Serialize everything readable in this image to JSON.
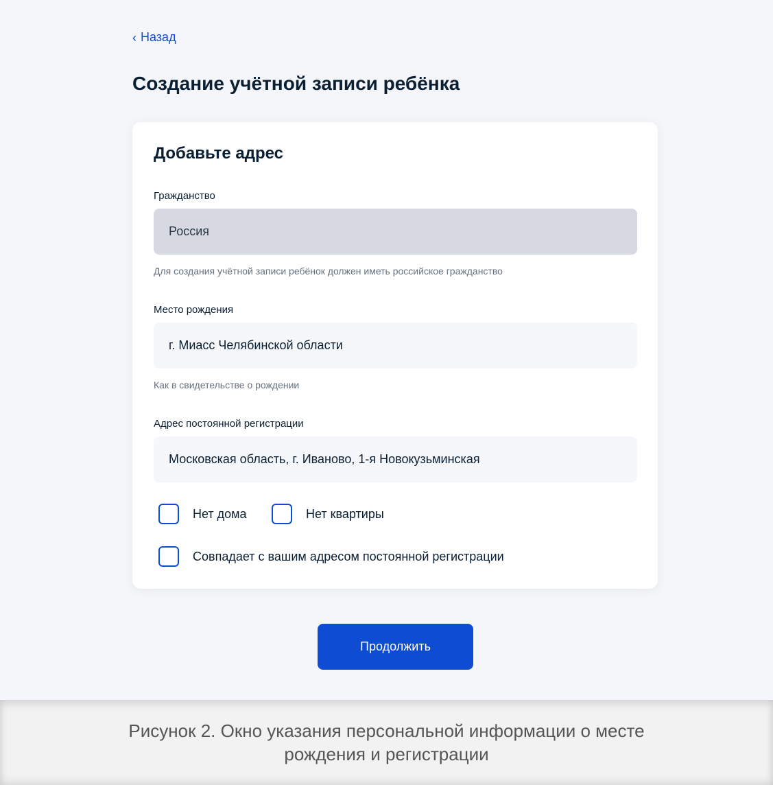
{
  "nav": {
    "back_label": "Назад"
  },
  "page": {
    "title": "Создание учётной записи ребёнка"
  },
  "form": {
    "title": "Добавьте адрес",
    "citizenship": {
      "label": "Гражданство",
      "value": "Россия",
      "hint": "Для создания учётной записи ребёнок должен иметь российское гражданство"
    },
    "birthplace": {
      "label": "Место рождения",
      "value": "г. Миасс Челябинской области",
      "hint": "Как в свидетельстве о рождении"
    },
    "registration": {
      "label": "Адрес постоянной регистрации",
      "value": "Московская область, г. Иваново, 1-я Новокузьминская"
    },
    "checkboxes": {
      "no_house": "Нет дома",
      "no_flat": "Нет квартиры",
      "same_address": "Совпадает с вашим адресом постоянной регистрации"
    }
  },
  "actions": {
    "continue_label": "Продолжить"
  },
  "caption": {
    "line1": "Рисунок 2. Окно указания персональной информации о месте",
    "line2": "рождения и регистрации"
  },
  "colors": {
    "accent": "#0d4cd3",
    "background": "#f5f6f9",
    "disabled_input": "#d6d9e1"
  }
}
